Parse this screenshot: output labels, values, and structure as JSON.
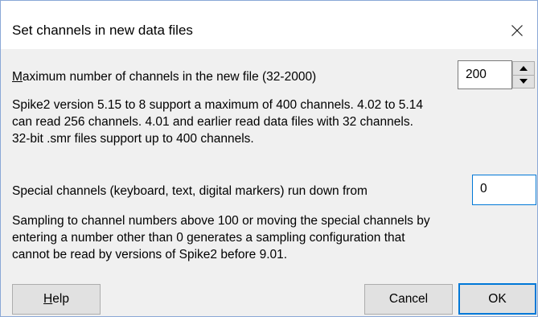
{
  "dialog": {
    "title": "Set channels in new data files",
    "close_icon": "close-icon"
  },
  "max_channels": {
    "label_accel": "M",
    "label_rest": "aximum number of channels in the new file (32-2000)",
    "value": "200",
    "spin_up_icon": "triangle-up-icon",
    "spin_down_icon": "triangle-down-icon"
  },
  "info_version": "Spike2 version 5.15 to 8 support a maximum of 400 channels. 4.02 to 5.14\ncan read 256 channels. 4.01 and earlier read data files with 32 channels.\n32-bit .smr files support up to 400 channels.",
  "special": {
    "label": "Special channels (keyboard, text, digital markers) run down from",
    "value": "0"
  },
  "info_sampling": "Sampling to channel numbers above 100 or moving the special channels by\nentering a number other than 0 generates a sampling configuration that\ncannot be read by versions of Spike2 before 9.01.",
  "buttons": {
    "help_accel": "H",
    "help_rest": "elp",
    "cancel": "Cancel",
    "ok": "OK"
  },
  "colors": {
    "dialog_bg": "#f0f0f0",
    "titlebar_bg": "#ffffff",
    "focus_border": "#0078d7",
    "button_bg": "#e1e1e1"
  }
}
